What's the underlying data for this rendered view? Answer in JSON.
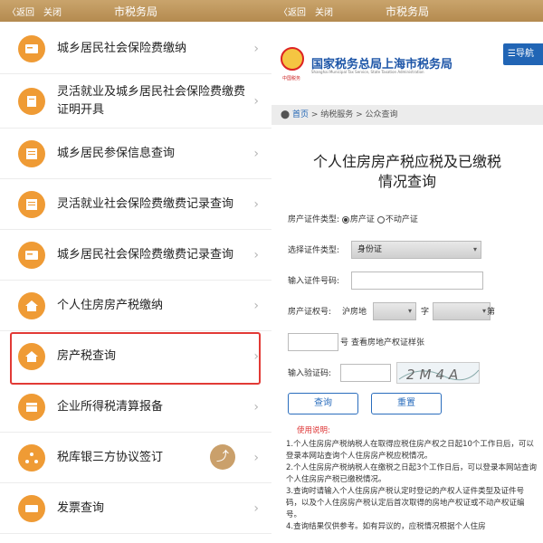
{
  "left_screen": {
    "topbar": {
      "back": "〈返回",
      "close": "关闭",
      "title": "市税务局"
    },
    "menu_items": [
      {
        "label": "城乡居民社会保险费缴纳",
        "icon": "card-icon"
      },
      {
        "label": "灵活就业及城乡居民社会保险费缴费证明开具",
        "icon": "document-icon"
      },
      {
        "label": "城乡居民参保信息查询",
        "icon": "list-icon"
      },
      {
        "label": "灵活就业社会保险费缴费记录查询",
        "icon": "list-icon"
      },
      {
        "label": "城乡居民社会保险费缴费记录查询",
        "icon": "card-icon"
      },
      {
        "label": "个人住房房产税缴纳",
        "icon": "house-icon"
      },
      {
        "label": "房产税查询",
        "icon": "house-icon"
      },
      {
        "label": "企业所得税清算报备",
        "icon": "ledger-icon"
      },
      {
        "label": "税库银三方协议签订",
        "icon": "network-icon"
      },
      {
        "label": "发票查询",
        "icon": "ticket-icon"
      }
    ],
    "selected_item": "房产税查询",
    "chevron": "›"
  },
  "right_screen": {
    "topbar": {
      "back": "〈返回",
      "close": "关闭",
      "title": "市税务局"
    },
    "site_name": "国家税务总局上海市税务局",
    "site_sub": "Shanghai Municipal Tax Service, State Taxation Administration",
    "brand_small": "中国税务",
    "nav_button": "☰导航",
    "breadcrumb": {
      "home": "首页",
      "sep1": " > ",
      "mid": "纳税服务",
      "sep2": " > ",
      "current": "公众查询"
    },
    "page_title": "个人住房房产税应税及已缴税情况查询",
    "form": {
      "cert_type_label": "房产证件类型:",
      "cert_option_1": "房产证",
      "cert_option_2": "不动产证",
      "id_type_label": "选择证件类型:",
      "id_type_value": "身份证",
      "id_number_label": "输入证件号码:",
      "property_no_label": "房产证权号:",
      "prefix": "沪房地",
      "char_zi": "字",
      "char_di": "第",
      "num_suffix": "号",
      "sample_link": "查看房地产权证样张",
      "captcha_label": "输入验证码:",
      "captcha_text": "2M4A",
      "query_button": "查询",
      "reset_button": "重置"
    },
    "notes": {
      "heading": "使用说明:",
      "items": [
        "1.个人住房房产税纳税人在取得应税住房产权之日起10个工作日后，可以登录本网站查询个人住房房产税应税情况。",
        "2.个人住房房产税纳税人在缴税之日起3个工作日后，可以登录本网站查询个人住房房产税已缴税情况。",
        "3.查询时请输入个人住房房产税认定时登记的产权人证件类型及证件号码，以及个人住房房产税认定后首次取得的房地产权证或不动产权证编号。",
        "4.查询结果仅供参考。如有异议的，应税情况根据个人住房"
      ]
    }
  },
  "colors": {
    "topbar_gold": "#c9a46c",
    "icon_orange": "#ef9b35",
    "highlight_red": "#e23a36",
    "brand_blue": "#1e56a8"
  }
}
